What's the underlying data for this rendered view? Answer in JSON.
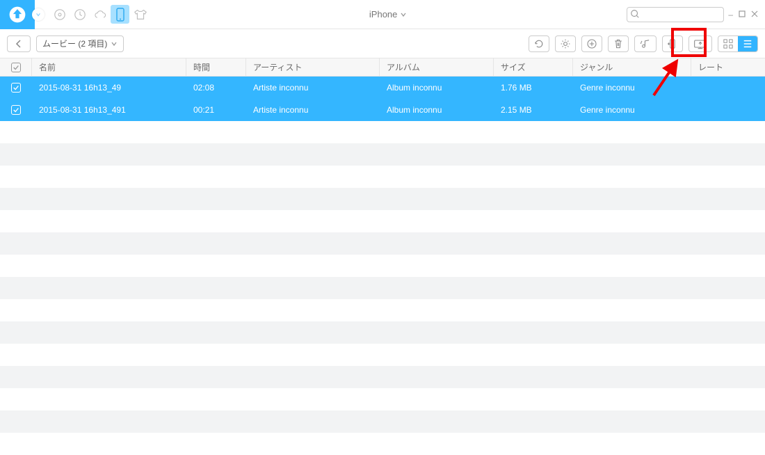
{
  "header": {
    "device": "iPhone",
    "search_placeholder": ""
  },
  "toolbar": {
    "breadcrumb": "ムービー (2 項目)"
  },
  "columns": {
    "check": "",
    "name": "名前",
    "time": "時間",
    "artist": "アーティスト",
    "album": "アルバム",
    "size": "サイズ",
    "genre": "ジャンル",
    "rate": "レート"
  },
  "rows": [
    {
      "checked": true,
      "name": "2015-08-31 16h13_49",
      "time": "02:08",
      "artist": "Artiste inconnu",
      "album": "Album inconnu",
      "size": "1.76 MB",
      "genre": "Genre inconnu",
      "rate": ""
    },
    {
      "checked": true,
      "name": "2015-08-31 16h13_491",
      "time": "00:21",
      "artist": "Artiste inconnu",
      "album": "Album inconnu",
      "size": "2.15 MB",
      "genre": "Genre inconnu",
      "rate": ""
    }
  ]
}
